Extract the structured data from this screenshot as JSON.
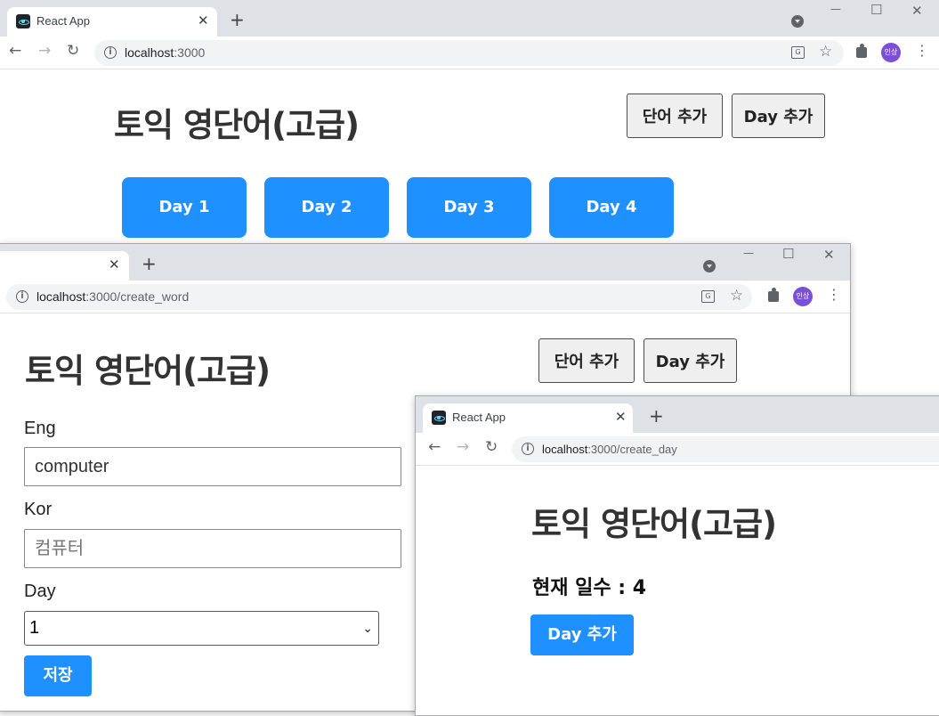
{
  "windows": {
    "main": {
      "tab_title": "React App",
      "url_host": "localhost",
      "url_path": ":3000",
      "heading": "토익 영단어(고급)",
      "buttons": {
        "add_word": "단어 추가",
        "add_day": "Day 추가"
      },
      "days": [
        "Day 1",
        "Day 2",
        "Day 3",
        "Day 4"
      ]
    },
    "create_word": {
      "url_host": "localhost",
      "url_path": ":3000/create_word",
      "heading": "토익 영단어(고급)",
      "buttons": {
        "add_word": "단어 추가",
        "add_day": "Day 추가"
      },
      "form": {
        "eng_label": "Eng",
        "eng_value": "computer",
        "kor_label": "Kor",
        "kor_placeholder": "컴퓨터",
        "day_label": "Day",
        "day_selected": "1",
        "save_label": "저장"
      }
    },
    "create_day": {
      "tab_title": "React App",
      "url_host": "localhost",
      "url_path": ":3000/create_day",
      "heading": "토익 영단어(고급)",
      "current_days_label": "현재 일수 : 4",
      "add_day_label": "Day 추가"
    }
  },
  "browser": {
    "close_glyph": "✕",
    "new_tab_glyph": "+",
    "avatar_text": "인상",
    "translate_glyph": "G",
    "star_glyph": "☆",
    "menu_glyph": "⋮",
    "back_glyph": "←",
    "forward_glyph": "→",
    "reload_glyph": "↻",
    "minimize_glyph": "—",
    "maximize_glyph": "☐",
    "info_glyph": "i",
    "chevron_glyph": "⌄"
  },
  "colors": {
    "accent_blue": "#1e90ff",
    "tabstrip": "#dee1e6",
    "avatar": "#7b4fd8"
  }
}
